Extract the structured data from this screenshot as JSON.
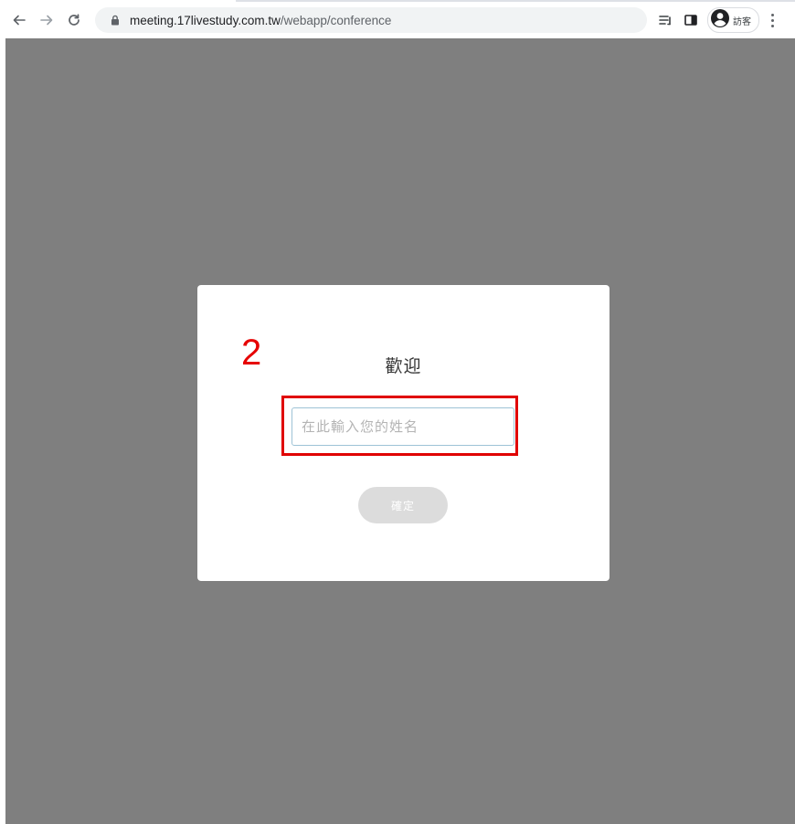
{
  "browser": {
    "url_host": "meeting.17livestudy.com.tw",
    "url_path": "/webapp/conference",
    "profile_label": "訪客",
    "icons": {
      "back": "back-arrow-icon",
      "forward": "forward-arrow-icon",
      "reload": "reload-icon",
      "lock": "lock-icon",
      "reading_list": "reading-list-icon",
      "side_panel": "side-panel-icon",
      "profile": "profile-icon",
      "menu": "kebab-menu-icon"
    }
  },
  "dialog": {
    "title": "歡迎",
    "name_placeholder": "在此輸入您的姓名",
    "name_value": "",
    "confirm_label": "確定"
  },
  "annotation": {
    "step_number": "2",
    "color": "#e60000"
  },
  "colors": {
    "overlay": "#7f7f7f",
    "button_disabled": "#dcdcdc"
  }
}
